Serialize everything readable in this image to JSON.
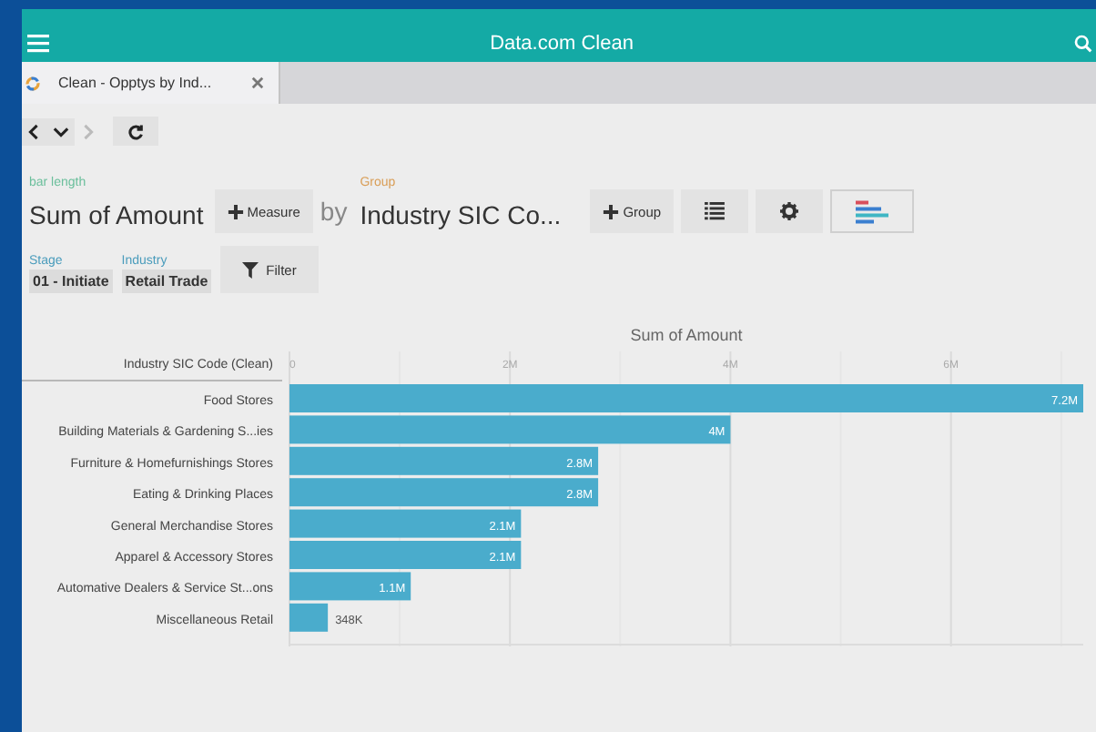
{
  "header": {
    "title": "Data.com Clean"
  },
  "tabs": [
    {
      "label": "Clean - Opptys by Ind...",
      "selected": true
    }
  ],
  "nav": [
    {
      "kind": "back",
      "disabled": false
    },
    {
      "kind": "down",
      "disabled": false
    },
    {
      "kind": "forward",
      "disabled": true
    },
    {
      "kind": "refresh",
      "disabled": false
    }
  ],
  "measure": {
    "caption": "bar length",
    "value": "Sum of Amount",
    "button": "Measure"
  },
  "by": "by",
  "group": {
    "caption": "Group",
    "value": "Industry SIC Co...",
    "button": "Group"
  },
  "view_buttons": [
    {
      "kind": "list",
      "selected": false
    },
    {
      "kind": "settings",
      "selected": false
    },
    {
      "kind": "chart",
      "selected": true
    }
  ],
  "filters": [
    {
      "caption": "Stage",
      "value": "01 - Initiate"
    },
    {
      "caption": "Industry",
      "value": "Retail Trade"
    }
  ],
  "filter_button": "Filter",
  "chart": {
    "axis_header": "Industry SIC Code (Clean)",
    "chart_data": {
      "type": "bar",
      "orientation": "horizontal",
      "title": "Sum of Amount",
      "categories": [
        "Food Stores",
        "Building Materials & Gardening S...ies",
        "Furniture & Homefurnishings Stores",
        "Eating & Drinking Places",
        "General Merchandise Stores",
        "Apparel & Accessory Stores",
        "Automative Dealers & Service St...ons",
        "Miscellaneous Retail"
      ],
      "values": [
        7200000,
        4000000,
        2800000,
        2800000,
        2100000,
        2100000,
        1100000,
        348000
      ],
      "value_labels": [
        "7.2M",
        "4M",
        "2.8M",
        "2.8M",
        "2.1M",
        "2.1M",
        "1.1M",
        "348K"
      ],
      "grid": true,
      "xlim": [
        0,
        7200000
      ],
      "xticks": [
        {
          "value": 0,
          "label": "0"
        },
        {
          "value": 2000000,
          "label": "2M"
        },
        {
          "value": 4000000,
          "label": "4M"
        },
        {
          "value": 6000000,
          "label": "6M"
        }
      ]
    }
  }
}
